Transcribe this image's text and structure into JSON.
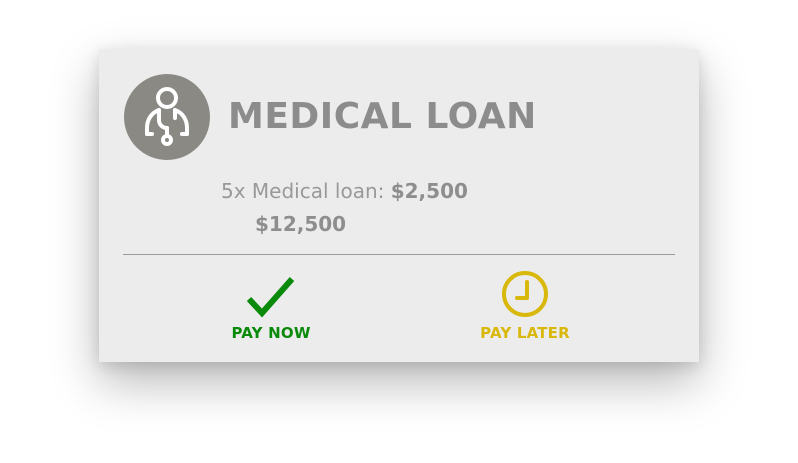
{
  "card": {
    "title": "MEDICAL LOAN",
    "icon": "doctor-stethoscope-icon",
    "detail": {
      "prefix": "5x Medical loan:",
      "amount": "$2,500",
      "total": "$12,500"
    }
  },
  "actions": {
    "pay_now": {
      "label": "PAY NOW",
      "icon": "checkmark-icon",
      "color": "#0a8a0a"
    },
    "pay_later": {
      "label": "PAY LATER",
      "icon": "clock-icon",
      "color": "#d9b80c"
    }
  },
  "colors": {
    "card_background": "#ececec",
    "avatar_background": "#8a8983",
    "title_text": "#8c8c8c"
  }
}
